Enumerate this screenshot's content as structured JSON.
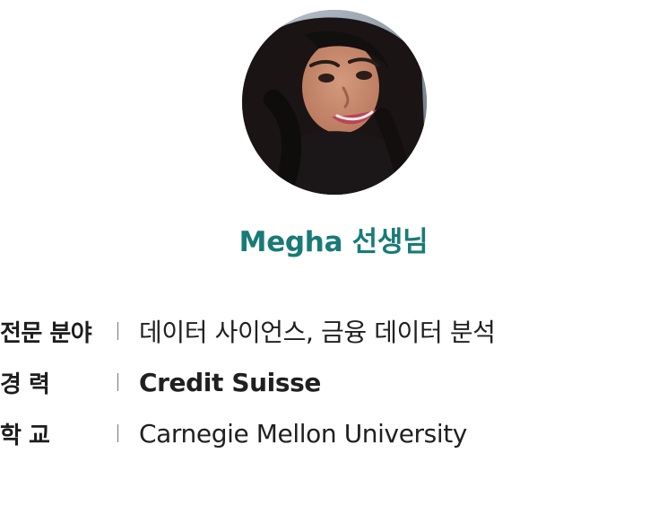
{
  "profile": {
    "name": "Megha 선생님"
  },
  "details": [
    {
      "label": "전문 분야",
      "value": "데이터 사이언스, 금융 데이터 분석",
      "strong": false
    },
    {
      "label": "경 력",
      "value": "Credit Suisse",
      "strong": true
    },
    {
      "label": "학 교",
      "value": "Carnegie Mellon University",
      "strong": false
    }
  ],
  "colors": {
    "accent": "#187b78",
    "text": "#1f1f1f"
  }
}
